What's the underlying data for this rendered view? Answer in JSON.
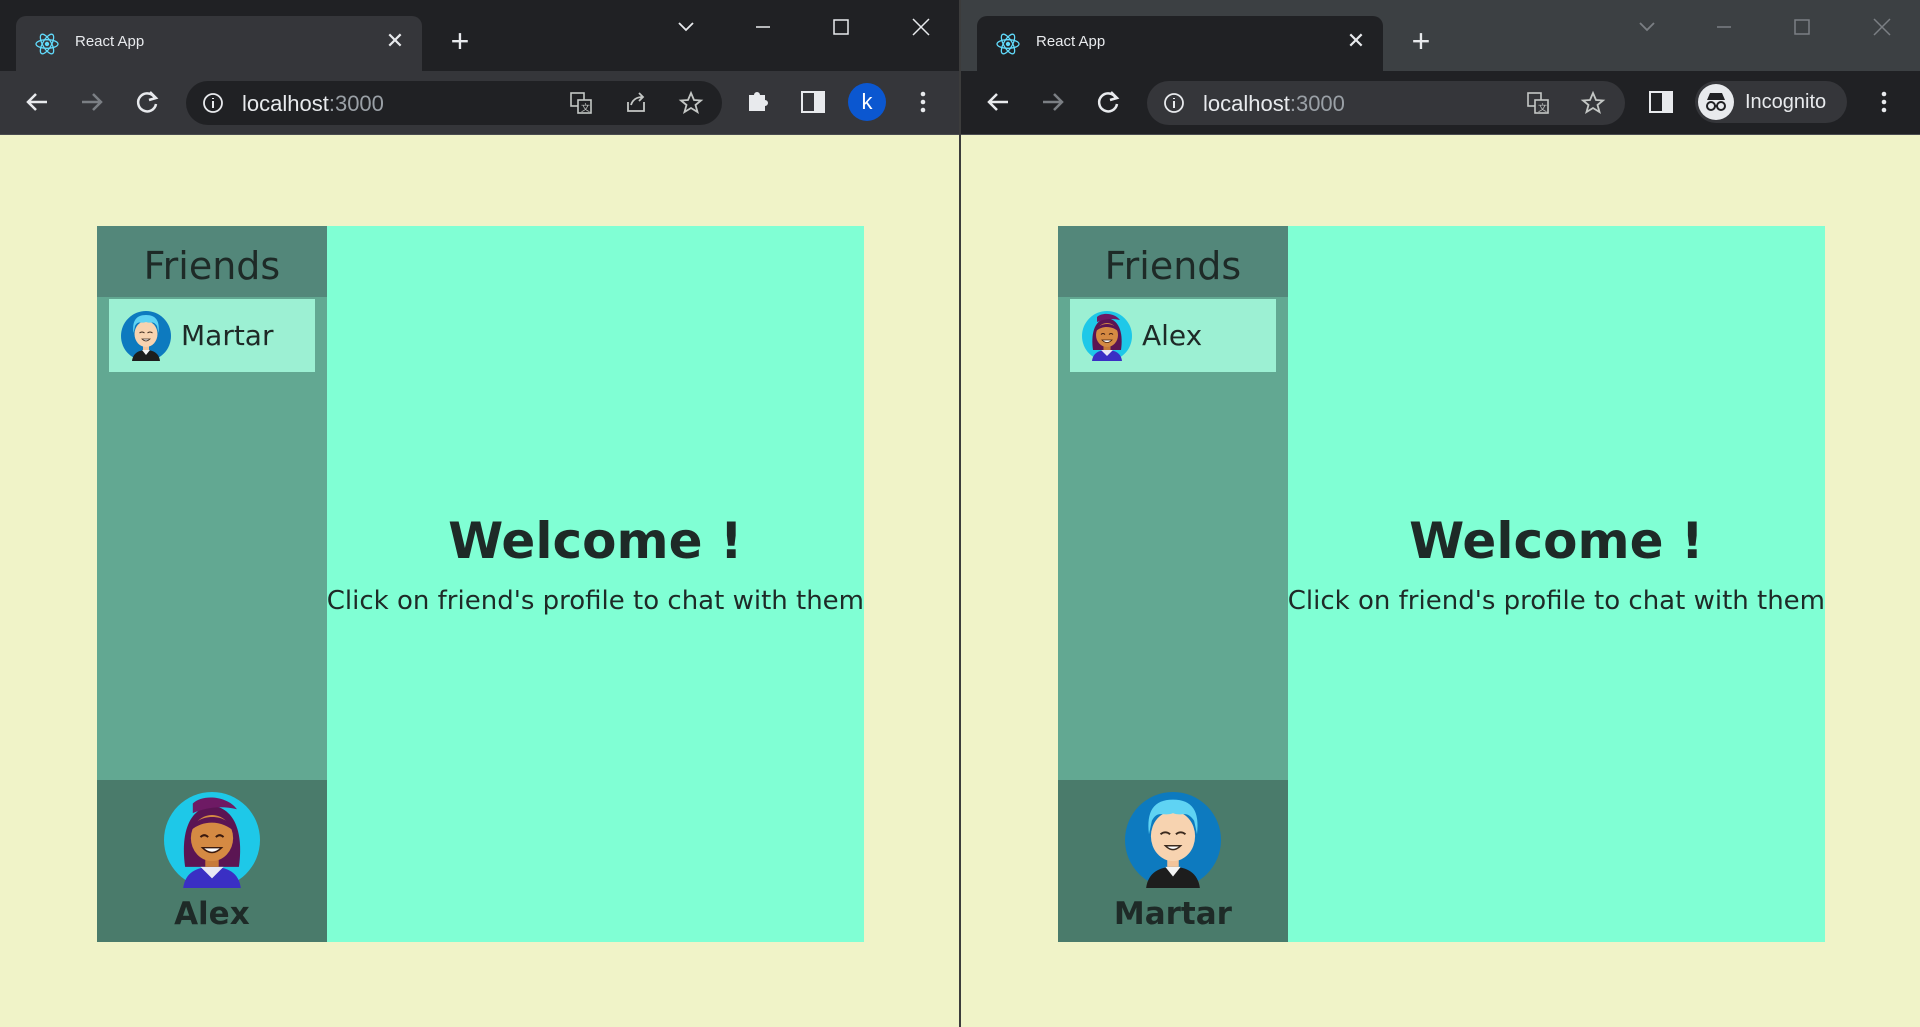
{
  "windows": [
    {
      "tab": {
        "title": "React App"
      },
      "omnibox": {
        "host": "localhost",
        "port": ":3000"
      },
      "profile": {
        "initial": "k"
      },
      "app": {
        "sidebar_title": "Friends",
        "friends": [
          {
            "name": "Martar",
            "avatar": "man-avatar-icon"
          }
        ],
        "current_user": {
          "name": "Alex",
          "avatar": "woman-avatar-icon"
        },
        "welcome_title": "Welcome !",
        "welcome_subtitle": "Click on friend's profile to chat with them"
      }
    },
    {
      "tab": {
        "title": "React App"
      },
      "omnibox": {
        "host": "localhost",
        "port": ":3000"
      },
      "profile": {
        "label": "Incognito"
      },
      "app": {
        "sidebar_title": "Friends",
        "friends": [
          {
            "name": "Alex",
            "avatar": "woman-avatar-icon"
          }
        ],
        "current_user": {
          "name": "Martar",
          "avatar": "man-avatar-icon"
        },
        "welcome_title": "Welcome !",
        "welcome_subtitle": "Click on friend's profile to chat with them"
      }
    }
  ],
  "colors": {
    "page_background": "#f0f3c8",
    "sidebar": "#62a892",
    "sidebar_header": "#53877a",
    "self_panel": "#4a7b6b",
    "friend_item": "#9cf0d3",
    "main_panel": "#80ffd4",
    "text": "#1e2a27"
  }
}
